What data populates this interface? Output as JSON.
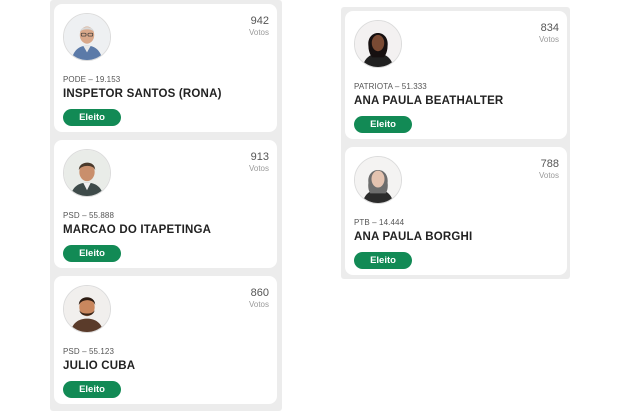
{
  "candidates_left": [
    {
      "votes": "942",
      "votes_label": "Votos",
      "party": "PODE – 19.153",
      "name": "INSPETOR SANTOS (RONA)",
      "status": "Eleito"
    },
    {
      "votes": "913",
      "votes_label": "Votos",
      "party": "PSD – 55.888",
      "name": "MARCAO DO ITAPETINGA",
      "status": "Eleito"
    },
    {
      "votes": "860",
      "votes_label": "Votos",
      "party": "PSD – 55.123",
      "name": "JULIO CUBA",
      "status": "Eleito"
    }
  ],
  "candidates_right": [
    {
      "votes": "834",
      "votes_label": "Votos",
      "party": "PATRIOTA – 51.333",
      "name": "ANA PAULA BEATHALTER",
      "status": "Eleito"
    },
    {
      "votes": "788",
      "votes_label": "Votos",
      "party": "PTB – 14.444",
      "name": "ANA PAULA BORGHI",
      "status": "Eleito"
    }
  ],
  "colors": {
    "badge": "#128a55",
    "panel": "#ececec",
    "card": "#ffffff"
  },
  "icons": {
    "avatar": "candidate-photo"
  }
}
